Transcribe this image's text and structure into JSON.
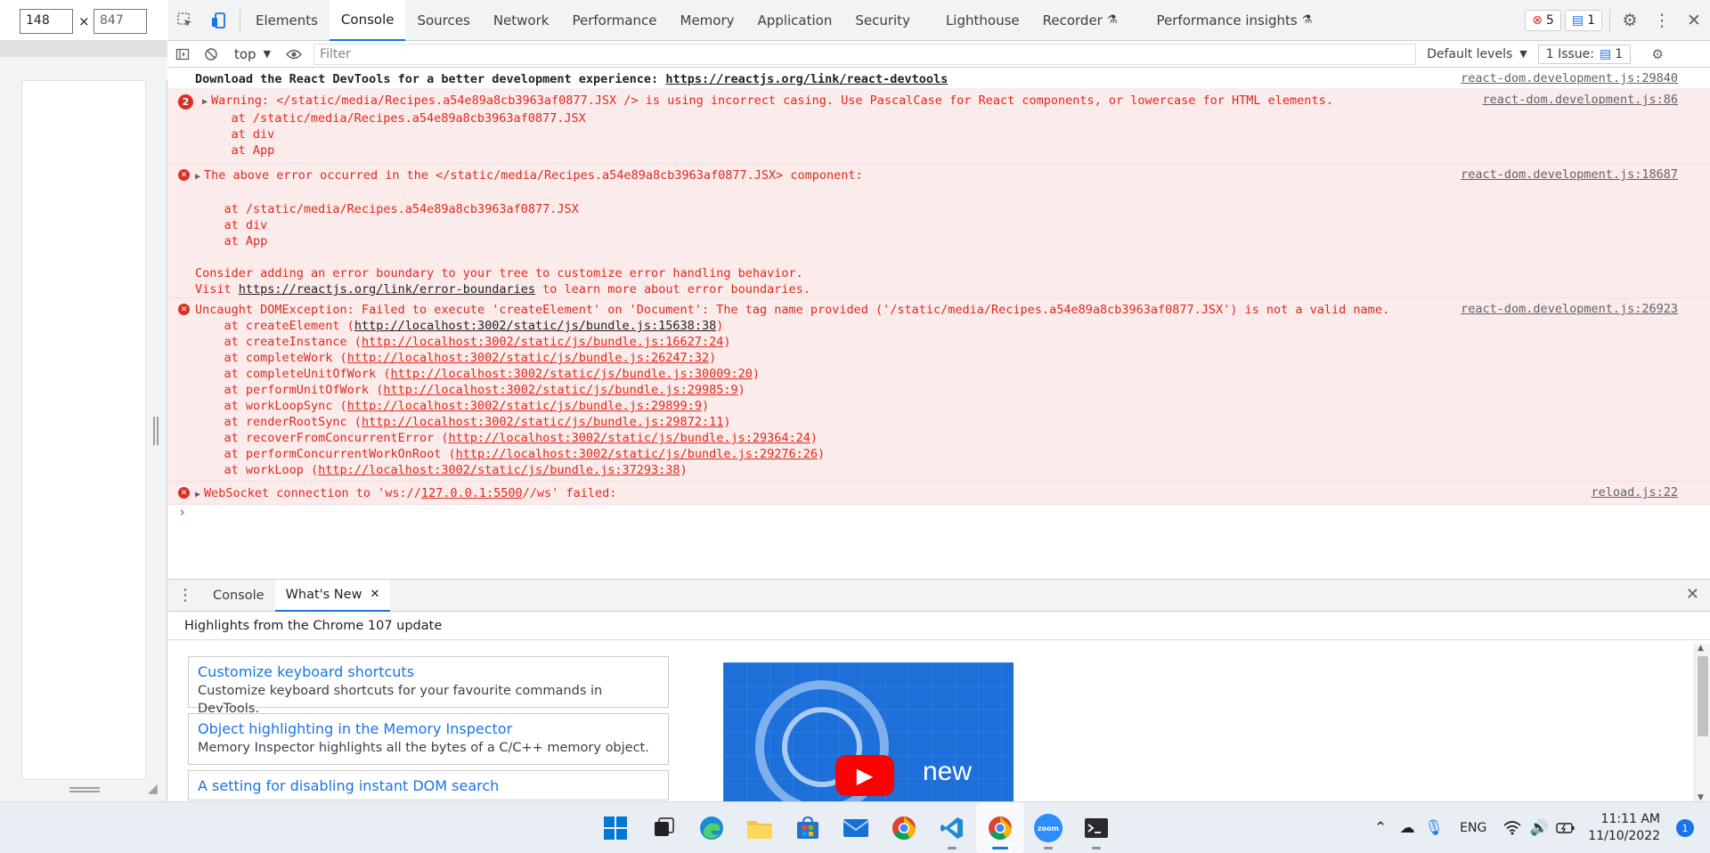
{
  "viewport": {
    "width": "148",
    "height": "847",
    "times": "×"
  },
  "tabs": [
    "Elements",
    "Console",
    "Sources",
    "Network",
    "Performance",
    "Memory",
    "Application",
    "Security",
    "Lighthouse",
    "Recorder",
    "Performance insights"
  ],
  "badges": {
    "errors": "5",
    "info": "1"
  },
  "console_toolbar": {
    "context": "top",
    "filter_placeholder": "Filter",
    "levels": "Default levels",
    "issues": "1 Issue:",
    "issues_count": "1"
  },
  "messages": {
    "m1": {
      "text": "Download the React DevTools for a better development experience: ",
      "link": "https://reactjs.org/link/react-devtools",
      "src": "react-dom.development.js:29840"
    },
    "m2": {
      "count": "2",
      "l1": "Warning: </static/media/Recipes.a54e89a8cb3963af0877.JSX /> is using incorrect casing. Use PascalCase for React components, or lowercase for HTML elements.",
      "l2": "    at /static/media/Recipes.a54e89a8cb3963af0877.JSX",
      "l3": "    at div",
      "l4": "    at App",
      "src": "react-dom.development.js:86"
    },
    "m3": {
      "l1": "The above error occurred in the </static/media/Recipes.a54e89a8cb3963af0877.JSX> component:",
      "l2": "    at /static/media/Recipes.a54e89a8cb3963af0877.JSX",
      "l3": "    at div",
      "l4": "    at App",
      "l5": "Consider adding an error boundary to your tree to customize error handling behavior.",
      "l6a": "Visit ",
      "l6b": "https://reactjs.org/link/error-boundaries",
      "l6c": " to learn more about error boundaries.",
      "src": "react-dom.development.js:18687"
    },
    "m4": {
      "l1": "Uncaught DOMException: Failed to execute 'createElement' on 'Document': The tag name provided ('/static/media/Recipes.a54e89a8cb3963af0877.JSX') is not a valid name.",
      "src": "react-dom.development.js:26923",
      "stack": [
        {
          "fn": "    at createElement (",
          "url": "http://localhost:3002/static/js/bundle.js:15638:38"
        },
        {
          "fn": "    at createInstance (",
          "url": "http://localhost:3002/static/js/bundle.js:16627:24"
        },
        {
          "fn": "    at completeWork (",
          "url": "http://localhost:3002/static/js/bundle.js:26247:32"
        },
        {
          "fn": "    at completeUnitOfWork (",
          "url": "http://localhost:3002/static/js/bundle.js:30009:20"
        },
        {
          "fn": "    at performUnitOfWork (",
          "url": "http://localhost:3002/static/js/bundle.js:29985:9"
        },
        {
          "fn": "    at workLoopSync (",
          "url": "http://localhost:3002/static/js/bundle.js:29899:9"
        },
        {
          "fn": "    at renderRootSync (",
          "url": "http://localhost:3002/static/js/bundle.js:29872:11"
        },
        {
          "fn": "    at recoverFromConcurrentError (",
          "url": "http://localhost:3002/static/js/bundle.js:29364:24"
        },
        {
          "fn": "    at performConcurrentWorkOnRoot (",
          "url": "http://localhost:3002/static/js/bundle.js:29276:26"
        },
        {
          "fn": "    at workLoop (",
          "url": "http://localhost:3002/static/js/bundle.js:37293:38"
        }
      ]
    },
    "m5": {
      "a": "WebSocket connection to 'ws://",
      "b": "127.0.0.1:5500",
      "c": "//ws' failed:",
      "src": "reload.js:22"
    }
  },
  "drawer": {
    "tabs": [
      "Console",
      "What's New"
    ],
    "highlight": "Highlights from the Chrome 107 update",
    "cards": [
      {
        "title": "Customize keyboard shortcuts",
        "desc": "Customize keyboard shortcuts for your favourite commands in DevTools."
      },
      {
        "title": "Object highlighting in the Memory Inspector",
        "desc": "Memory Inspector highlights all the bytes of a C/C++ memory object."
      },
      {
        "title": "A setting for disabling instant DOM search",
        "desc": ""
      }
    ],
    "video_text": "new"
  },
  "taskbar": {
    "apps": [
      "windows-start",
      "task-view",
      "edge",
      "file-explorer",
      "microsoft-store",
      "mail",
      "chrome",
      "vscode",
      "chrome-active",
      "zoom",
      "terminal"
    ],
    "zoom_label": "zoom",
    "lang": "ENG",
    "time": "11:11 AM",
    "date": "11/10/2022",
    "notifications": "1"
  }
}
